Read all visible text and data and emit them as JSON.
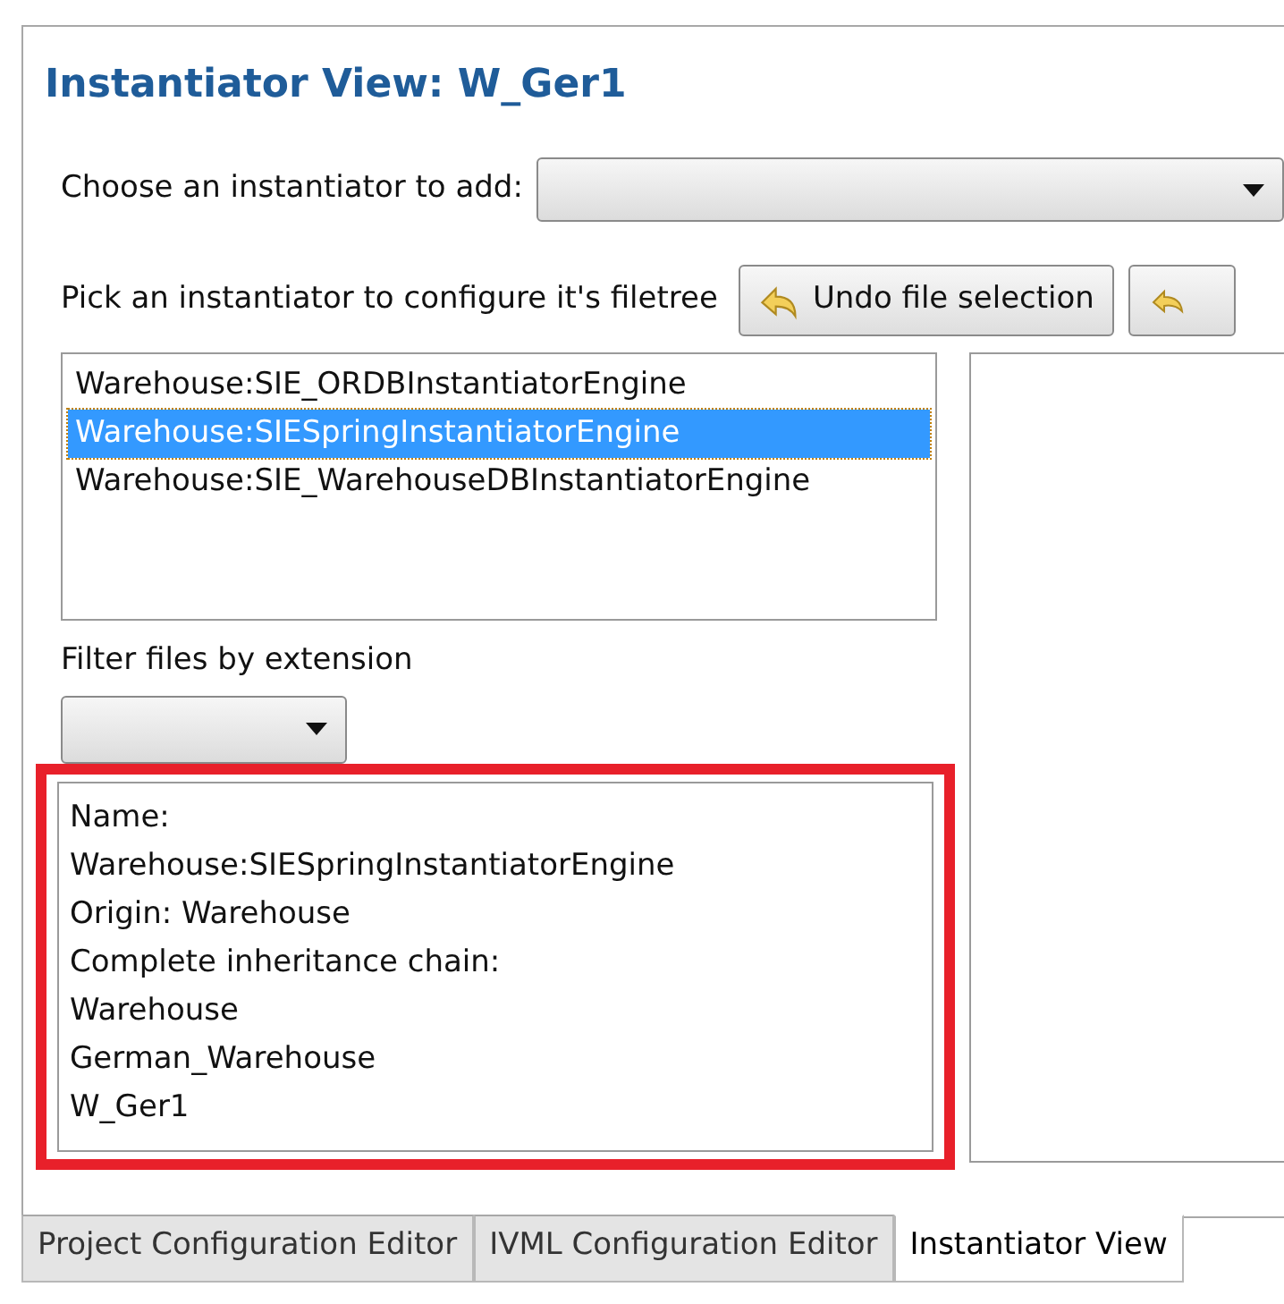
{
  "view": {
    "title": "Instantiator View: W_Ger1"
  },
  "add_row": {
    "label": "Choose an instantiator to add:"
  },
  "configure_row": {
    "label": "Pick an instantiator to configure it's filetree",
    "button": "Undo file selection"
  },
  "instantiators": [
    {
      "label": "Warehouse:SIE_ORDBInstantiatorEngine",
      "selected": false
    },
    {
      "label": "Warehouse:SIESpringInstantiatorEngine",
      "selected": true
    },
    {
      "label": "Warehouse:SIE_WarehouseDBInstantiatorEngine",
      "selected": false
    }
  ],
  "filter": {
    "label": "Filter files by extension"
  },
  "details": {
    "highlighted": true,
    "lines": [
      "Name:",
      "Warehouse:SIESpringInstantiatorEngine",
      "Origin: Warehouse",
      "Complete inheritance chain:",
      "Warehouse",
      "German_Warehouse",
      "W_Ger1"
    ]
  },
  "tabs": [
    {
      "label": "Project Configuration Editor",
      "selected": false
    },
    {
      "label": "IVML Configuration Editor",
      "selected": false
    },
    {
      "label": "Instantiator View",
      "selected": true
    }
  ]
}
